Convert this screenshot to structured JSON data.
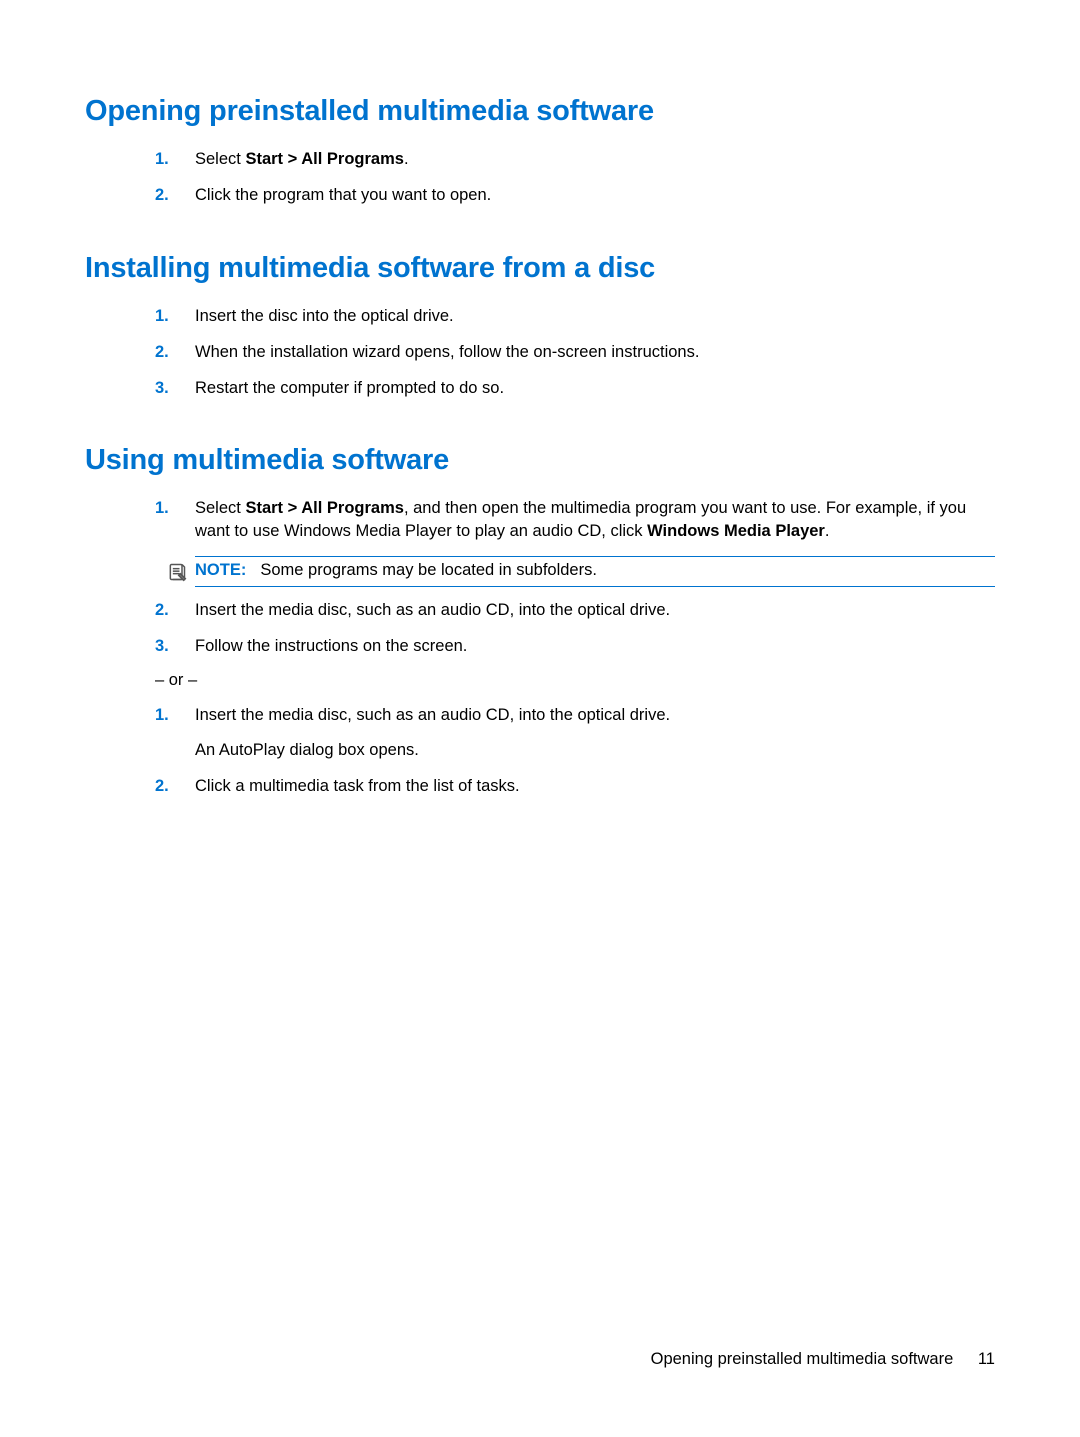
{
  "section1": {
    "heading": "Opening preinstalled multimedia software",
    "items": [
      {
        "num": "1.",
        "prefix": "Select ",
        "bold": "Start > All Programs",
        "suffix": "."
      },
      {
        "num": "2.",
        "text": "Click the program that you want to open."
      }
    ]
  },
  "section2": {
    "heading": "Installing multimedia software from a disc",
    "items": [
      {
        "num": "1.",
        "text": "Insert the disc into the optical drive."
      },
      {
        "num": "2.",
        "text": "When the installation wizard opens, follow the on-screen instructions."
      },
      {
        "num": "3.",
        "text": "Restart the computer if prompted to do so."
      }
    ]
  },
  "section3": {
    "heading": "Using multimedia software",
    "listA": {
      "item1": {
        "num": "1.",
        "prefix": "Select ",
        "bold1": "Start > All Programs",
        "mid": ", and then open the multimedia program you want to use. For example, if you want to use Windows Media Player to play an audio CD, click ",
        "bold2": "Windows Media Player",
        "suffix": "."
      },
      "note": {
        "label": "NOTE:",
        "text": "Some programs may be located in subfolders."
      },
      "item2": {
        "num": "2.",
        "text": "Insert the media disc, such as an audio CD, into the optical drive."
      },
      "item3": {
        "num": "3.",
        "text": "Follow the instructions on the screen."
      }
    },
    "or": "– or –",
    "listB": {
      "item1": {
        "num": "1.",
        "text": "Insert the media disc, such as an audio CD, into the optical drive.",
        "sub": "An AutoPlay dialog box opens."
      },
      "item2": {
        "num": "2.",
        "text": "Click a multimedia task from the list of tasks."
      }
    }
  },
  "footer": {
    "title": "Opening preinstalled multimedia software",
    "page": "11"
  }
}
